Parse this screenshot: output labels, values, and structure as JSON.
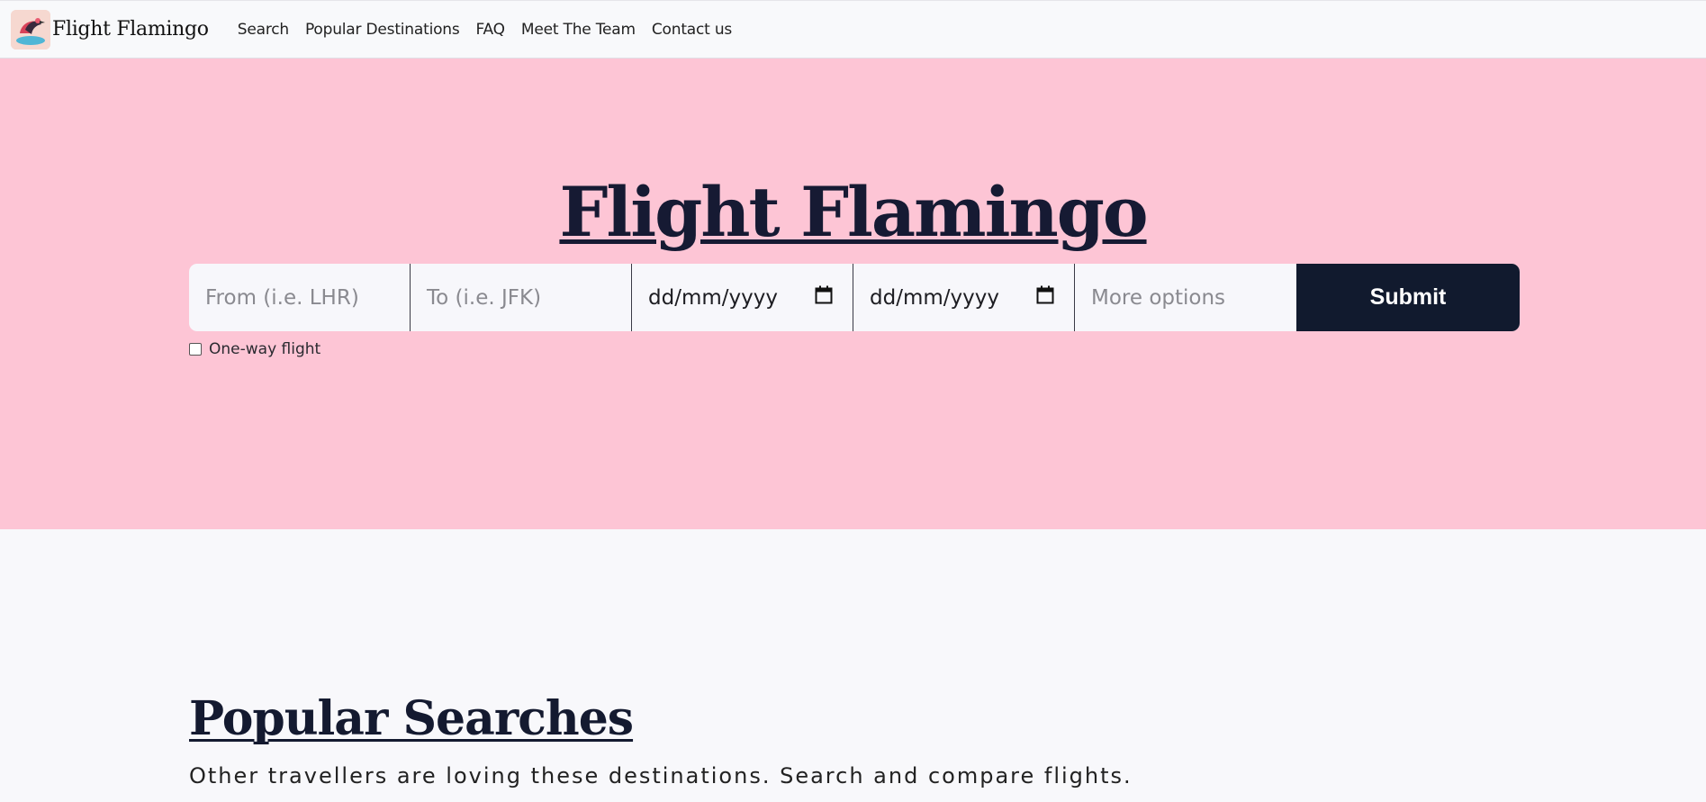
{
  "brand": {
    "name": "Flight Flamingo",
    "logo_icon": "flamingo-logo-icon"
  },
  "nav": {
    "items": [
      {
        "label": "Search"
      },
      {
        "label": "Popular Destinations"
      },
      {
        "label": "FAQ"
      },
      {
        "label": "Meet The Team"
      },
      {
        "label": "Contact us"
      }
    ]
  },
  "hero": {
    "title": "Flight Flamingo",
    "background": "#fdc5d5"
  },
  "search": {
    "from_placeholder": "From (i.e. LHR)",
    "to_placeholder": "To (i.e. JFK)",
    "depart_date": "dd/mm/yyyy",
    "return_date": "dd/mm/yyyy",
    "more_options_placeholder": "More options",
    "submit_label": "Submit",
    "submit_color": "#111a2e"
  },
  "oneway": {
    "label": "One-way flight",
    "checked": false
  },
  "popular": {
    "title": "Popular Searches",
    "subtitle": "Other travellers are loving these destinations. Search and compare flights."
  }
}
